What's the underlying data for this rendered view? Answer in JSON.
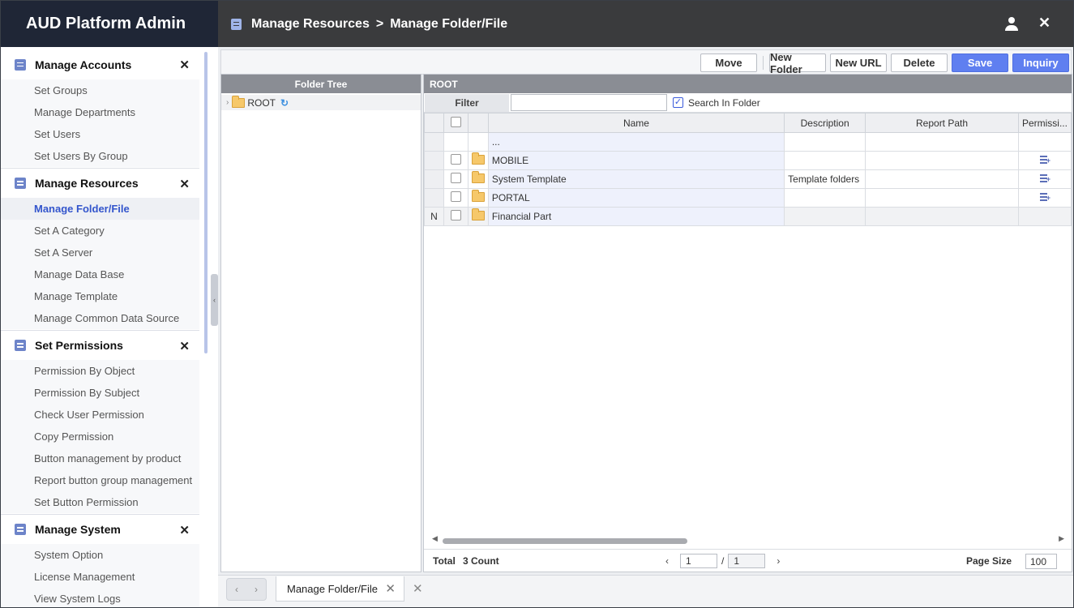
{
  "app": {
    "title": "AUD Platform Admin"
  },
  "header": {
    "crumb1": "Manage Resources",
    "separator": ">",
    "crumb2": "Manage Folder/File"
  },
  "icons": {
    "doc": "document-icon",
    "user": "user-icon",
    "close": "close-icon",
    "folder": "folder-icon",
    "refresh": "refresh-icon",
    "permission": "permission-edit-icon"
  },
  "sidebar": {
    "sections": [
      {
        "title": "Manage Accounts",
        "items": [
          "Set Groups",
          "Manage Departments",
          "Set Users",
          "Set Users By Group"
        ]
      },
      {
        "title": "Manage Resources",
        "items": [
          "Manage Folder/File",
          "Set A Category",
          "Set A Server",
          "Manage Data Base",
          "Manage Template",
          "Manage Common Data Source"
        ]
      },
      {
        "title": "Set Permissions",
        "items": [
          "Permission By Object",
          "Permission By Subject",
          "Check User Permission",
          "Copy Permission",
          "Button management by product",
          "Report button group management",
          "Set Button Permission"
        ]
      },
      {
        "title": "Manage System",
        "items": [
          "System Option",
          "License Management",
          "View System Logs"
        ]
      }
    ],
    "active_item": "Manage Folder/File"
  },
  "toolbar": {
    "move": "Move",
    "new_folder": "New Folder",
    "new_url": "New URL",
    "delete": "Delete",
    "save": "Save",
    "inquiry": "Inquiry"
  },
  "tree": {
    "title": "Folder Tree",
    "root_label": "ROOT"
  },
  "grid": {
    "title": "ROOT",
    "filter_label": "Filter",
    "filter_value": "",
    "search_in_folder_label": "Search In Folder",
    "search_in_folder_checked": true,
    "columns": [
      "Name",
      "Description",
      "Report Path",
      "Permissi..."
    ],
    "parent_row": {
      "name": "..."
    },
    "rows": [
      {
        "marker": "",
        "name": "MOBILE",
        "description": "",
        "report_path": "",
        "has_permission_icon": true
      },
      {
        "marker": "",
        "name": "System Template",
        "description": "Template folders",
        "report_path": "",
        "has_permission_icon": true
      },
      {
        "marker": "",
        "name": "PORTAL",
        "description": "",
        "report_path": "",
        "has_permission_icon": true
      },
      {
        "marker": "N",
        "name": "Financial Part",
        "description": "",
        "report_path": "",
        "has_permission_icon": false
      }
    ]
  },
  "footer": {
    "total_label": "Total",
    "count_text": "3 Count",
    "current_page": "1",
    "page_separator": "/",
    "total_pages": "1",
    "page_size_label": "Page Size",
    "page_size": "100"
  },
  "tabs": [
    {
      "label": "Manage Folder/File"
    }
  ]
}
